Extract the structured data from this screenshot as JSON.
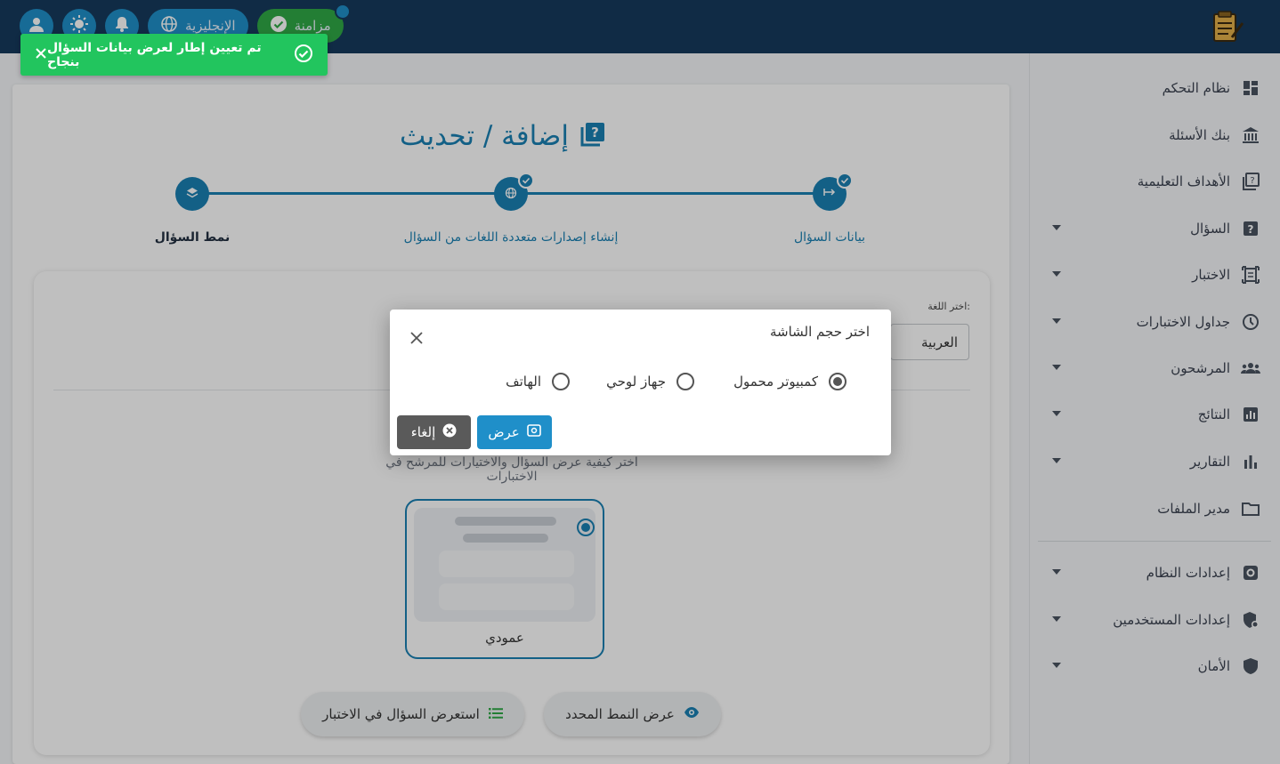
{
  "header": {
    "language_label": "الإنجليزية",
    "sync_label": "مزامنة",
    "icons": [
      "user-icon",
      "sun-icon",
      "bell-icon",
      "globe-icon",
      "check-circle-icon",
      "exam-logo"
    ]
  },
  "toast": {
    "message": "تم تعيين إطار لعرض بيانات السؤال بنجاح",
    "color": "#22c55e"
  },
  "sidebar": {
    "items": [
      {
        "label": "نظام التحكم",
        "icon": "dashboard-icon",
        "has_arrow": false
      },
      {
        "label": "بنك الأسئلة",
        "icon": "bank-icon",
        "has_arrow": false
      },
      {
        "label": "الأهداف التعليمية",
        "icon": "objectives-icon",
        "has_arrow": false
      },
      {
        "label": "السؤال",
        "icon": "question-icon",
        "has_arrow": true
      },
      {
        "label": "الاختبار",
        "icon": "exam-icon",
        "has_arrow": true
      },
      {
        "label": "جداول الاختبارات",
        "icon": "clock-icon",
        "has_arrow": true
      },
      {
        "label": "المرشحون",
        "icon": "people-icon",
        "has_arrow": true
      },
      {
        "label": "النتائج",
        "icon": "results-icon",
        "has_arrow": true
      },
      {
        "label": "التقارير",
        "icon": "reports-icon",
        "has_arrow": true
      },
      {
        "label": "مدير الملفات",
        "icon": "folder-icon",
        "has_arrow": false
      },
      {
        "label": "إعدادات النظام",
        "icon": "settings-icon",
        "has_arrow": true
      },
      {
        "label": "إعدادات المستخدمين",
        "icon": "user-settings-icon",
        "has_arrow": true
      },
      {
        "label": "الأمان",
        "icon": "shield-icon",
        "has_arrow": true
      }
    ]
  },
  "page": {
    "title": "إضافة / تحديث",
    "steps": [
      {
        "label": "بيانات السؤال",
        "completed": true
      },
      {
        "label": "إنشاء إصدارات متعددة اللغات من السؤال",
        "completed": true
      },
      {
        "label": "نمط السؤال",
        "completed": false,
        "active": true
      }
    ],
    "language_select_label": "اختر اللغة:",
    "language_select_value": "العربية",
    "hint": "اختر كيفية عرض السؤال والاختيارات للمرشح في الاختبارات",
    "layout_option_label": "عمودي",
    "preview_selected_button": "عرض النمط المحدد",
    "preview_question_button": "استعرض السؤال في الاختبار"
  },
  "dialog": {
    "title": "اختر حجم الشاشة",
    "options": [
      {
        "label": "كمبيوتر محمول",
        "checked": true
      },
      {
        "label": "جهاز لوحي",
        "checked": false
      },
      {
        "label": "الهاتف",
        "checked": false
      }
    ],
    "view_button": "عرض",
    "cancel_button": "إلغاء"
  },
  "colors": {
    "primary": "#1a80b3",
    "header": "#163a5c",
    "success": "#22c55e",
    "cancel": "#5a5a5a"
  }
}
